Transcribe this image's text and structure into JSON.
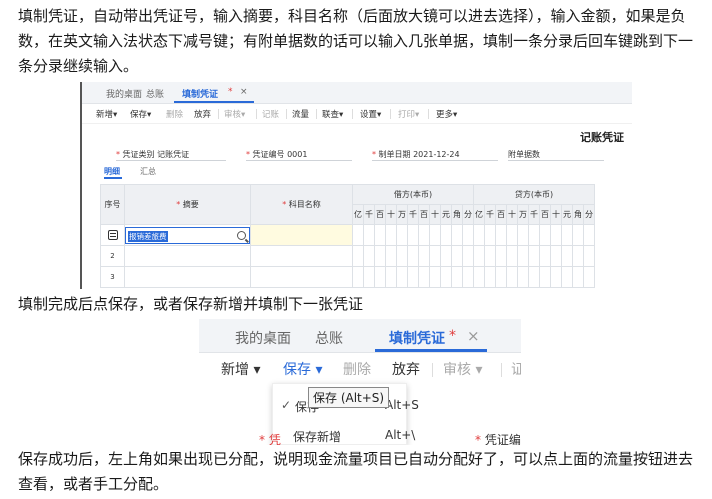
{
  "paragraphs": {
    "p1": "填制凭证，自动带出凭证号，输入摘要，科目名称（后面放大镜可以进去选择），输入金额，如果是负数，在英文输入法状态下减号键；有附单据数的话可以输入几张单据，填制一条分录后回车键跳到下一条分录继续输入。",
    "p2": "填制完成后点保存，或者保存新增并填制下一张凭证",
    "p3": "保存成功后，左上角如果出现已分配，说明现金流量项目已自动分配好了，可以点上面的流量按钮进去查看，或者手工分配。"
  },
  "shot1": {
    "tabs": [
      "我的桌面",
      "总账",
      "填制凭证",
      "×"
    ],
    "active_tab_marker": "*",
    "toolbar": [
      "新增",
      "保存",
      "删除",
      "放弃",
      "审核",
      "记账",
      "流量",
      "联查",
      "设置",
      "打印",
      "更多"
    ],
    "doc_title": "记账凭证",
    "fields": {
      "type_label": "凭证类别",
      "type_value": "记账凭证",
      "no_label": "凭证编号",
      "no_value": "0001",
      "date_label": "制单日期",
      "date_value": "2021-12-24",
      "attach_label": "附单据数"
    },
    "subtabs": [
      "明细",
      "汇总"
    ],
    "columns": {
      "seq": "序号",
      "summary": "摘要",
      "account": "科目名称",
      "debit": "借方(本币)",
      "credit": "贷方(本币)"
    },
    "digits": [
      "亿",
      "千",
      "百",
      "十",
      "万",
      "千",
      "百",
      "十",
      "元",
      "角",
      "分"
    ],
    "rows": [
      {
        "num": "",
        "summary": "报销差旅费"
      },
      {
        "num": "2",
        "summary": ""
      },
      {
        "num": "3",
        "summary": ""
      }
    ]
  },
  "shot2": {
    "tabs": [
      "我的桌面",
      "总账",
      "填制凭证",
      "×"
    ],
    "active_tab_marker": "*",
    "toolbar": [
      "新增",
      "保存",
      "删除",
      "放弃",
      "审核",
      "证"
    ],
    "tooltip": "保存 (Alt+S)",
    "menu": [
      {
        "label": "保存",
        "shortcut": "Alt+S"
      },
      {
        "label": "保存新增",
        "shortcut": "Alt+\\"
      }
    ],
    "field_fragments": [
      "* 凭",
      "* 凭证编"
    ]
  }
}
